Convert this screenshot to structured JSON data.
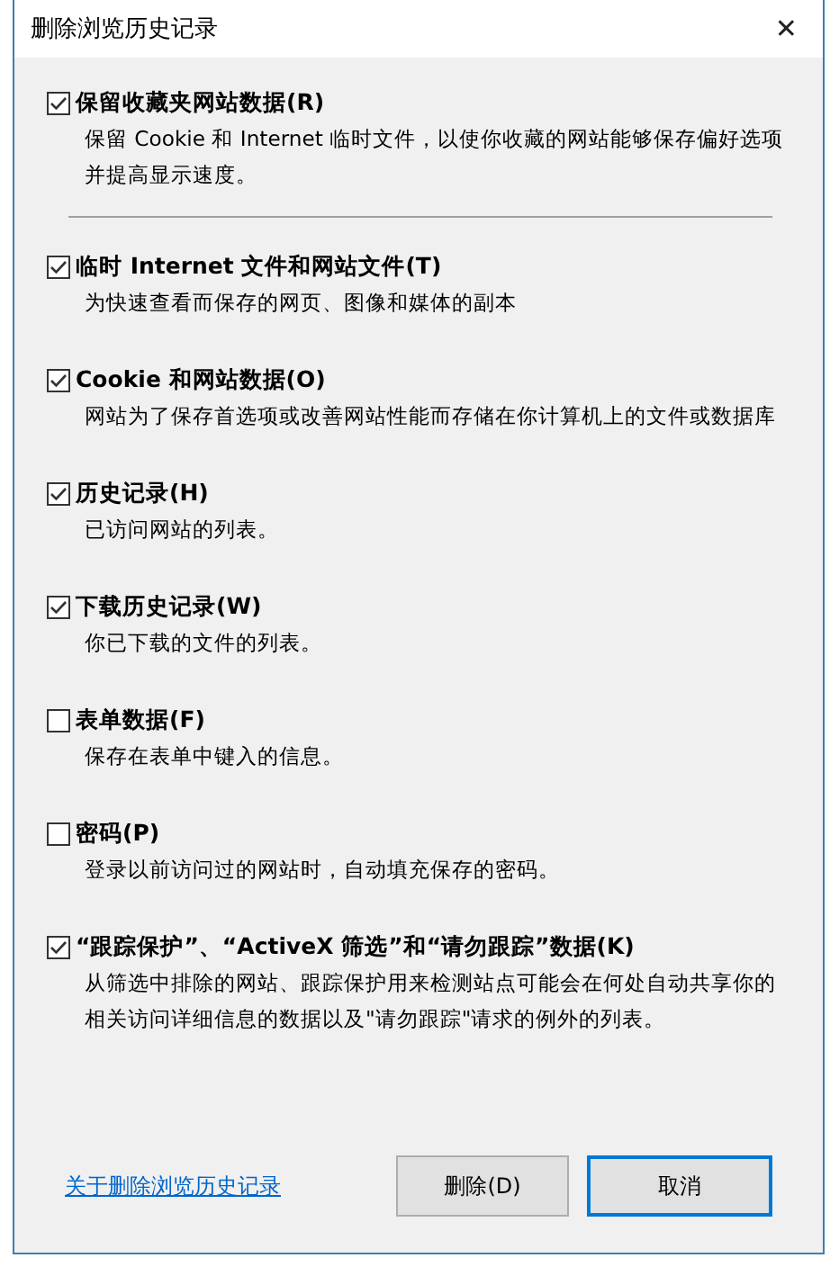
{
  "window": {
    "title": "删除浏览历史记录",
    "close": "✕"
  },
  "options": [
    {
      "label": "保留收藏夹网站数据(R)",
      "description": "保留 Cookie 和 Internet 临时文件，以使你收藏的网站能够保存偏好选项并提高显示速度。",
      "checked": true
    },
    {
      "label": "临时 Internet 文件和网站文件(T)",
      "description": "为快速查看而保存的网页、图像和媒体的副本",
      "checked": true
    },
    {
      "label": "Cookie 和网站数据(O)",
      "description": "网站为了保存首选项或改善网站性能而存储在你计算机上的文件或数据库",
      "checked": true
    },
    {
      "label": "历史记录(H)",
      "description": "已访问网站的列表。",
      "checked": true
    },
    {
      "label": "下载历史记录(W)",
      "description": "你已下载的文件的列表。",
      "checked": true
    },
    {
      "label": "表单数据(F)",
      "description": "保存在表单中键入的信息。",
      "checked": false
    },
    {
      "label": "密码(P)",
      "description": "登录以前访问过的网站时，自动填充保存的密码。",
      "checked": false
    },
    {
      "label": "“跟踪保护”、“ActiveX 筛选”和“请勿跟踪”数据(K)",
      "description": "从筛选中排除的网站、跟踪保护用来检测站点可能会在何处自动共享你的相关访问详细信息的数据以及\"请勿跟踪\"请求的例外的列表。",
      "checked": true
    }
  ],
  "help_link": "关于删除浏览历史记录",
  "buttons": [
    {
      "label": "删除(D)",
      "default": false
    },
    {
      "label": "取消",
      "default": true
    }
  ]
}
